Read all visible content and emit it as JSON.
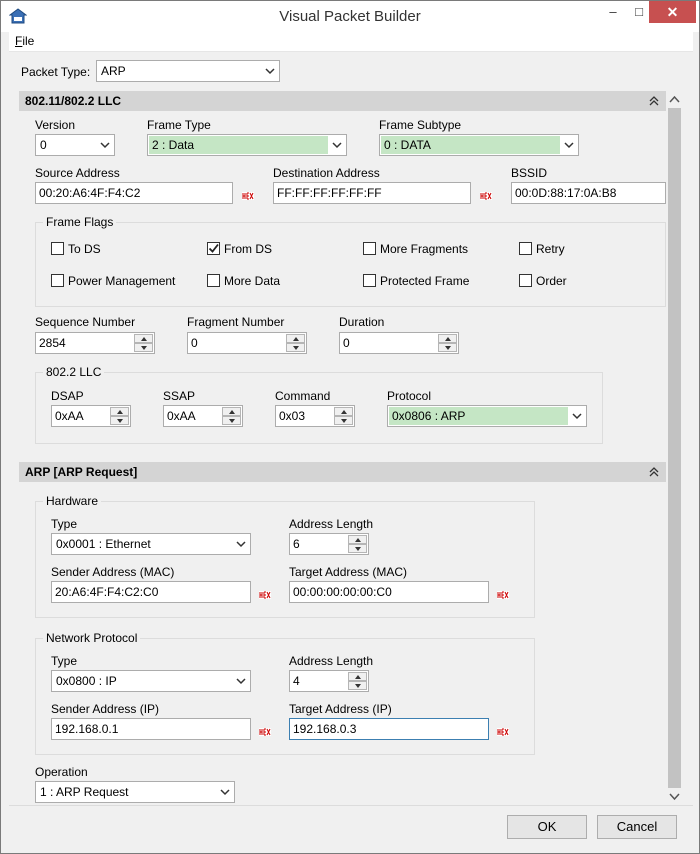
{
  "window": {
    "title": "Visual Packet Builder"
  },
  "menu": {
    "file_rest": "ile",
    "file_accel": "F"
  },
  "packet_type": {
    "label": "Packet Type:",
    "value": "ARP"
  },
  "llc_section": {
    "title": "802.11/802.2 LLC",
    "version": {
      "label": "Version",
      "value": "0"
    },
    "frame_type": {
      "label": "Frame Type",
      "value": "2 : Data"
    },
    "frame_subtype": {
      "label": "Frame Subtype",
      "value": "0 : DATA"
    },
    "source_address": {
      "label": "Source Address",
      "value": "00:20:A6:4F:F4:C2"
    },
    "destination_address": {
      "label": "Destination Address",
      "value": "FF:FF:FF:FF:FF:FF"
    },
    "bssid": {
      "label": "BSSID",
      "value": "00:0D:88:17:0A:B8"
    },
    "frame_flags": {
      "title": "Frame Flags",
      "flags": [
        {
          "label": "To DS",
          "checked": false
        },
        {
          "label": "From DS",
          "checked": true
        },
        {
          "label": "More Fragments",
          "checked": false
        },
        {
          "label": "Retry",
          "checked": false
        },
        {
          "label": "Power Management",
          "checked": false
        },
        {
          "label": "More Data",
          "checked": false
        },
        {
          "label": "Protected Frame",
          "checked": false
        },
        {
          "label": "Order",
          "checked": false
        }
      ]
    },
    "sequence_number": {
      "label": "Sequence Number",
      "value": "2854"
    },
    "fragment_number": {
      "label": "Fragment Number",
      "value": "0"
    },
    "duration": {
      "label": "Duration",
      "value": "0"
    },
    "llc": {
      "title": "802.2 LLC",
      "dsap": {
        "label": "DSAP",
        "value": "0xAA"
      },
      "ssap": {
        "label": "SSAP",
        "value": "0xAA"
      },
      "command": {
        "label": "Command",
        "value": "0x03"
      },
      "protocol": {
        "label": "Protocol",
        "value": "0x0806 : ARP"
      }
    }
  },
  "arp_section": {
    "title": "ARP [ARP Request]",
    "hardware": {
      "title": "Hardware",
      "type": {
        "label": "Type",
        "value": "0x0001 : Ethernet"
      },
      "address_length": {
        "label": "Address Length",
        "value": "6"
      },
      "sender": {
        "label": "Sender Address (MAC)",
        "value": "20:A6:4F:F4:C2:C0"
      },
      "target": {
        "label": "Target Address (MAC)",
        "value": "00:00:00:00:00:C0"
      }
    },
    "network": {
      "title": "Network Protocol",
      "type": {
        "label": "Type",
        "value": "0x0800 : IP"
      },
      "address_length": {
        "label": "Address Length",
        "value": "4"
      },
      "sender": {
        "label": "Sender Address (IP)",
        "value": "192.168.0.1"
      },
      "target": {
        "label": "Target Address (IP)",
        "value": "192.168.0.3"
      }
    },
    "operation": {
      "label": "Operation",
      "value": "1 : ARP Request"
    }
  },
  "buttons": {
    "ok": "OK",
    "cancel": "Cancel"
  },
  "colors": {
    "field_highlight": "#c5e6c5",
    "section_header": "#d4d4d4",
    "close_button": "#c75050",
    "hex_icon": "#cc0000"
  }
}
